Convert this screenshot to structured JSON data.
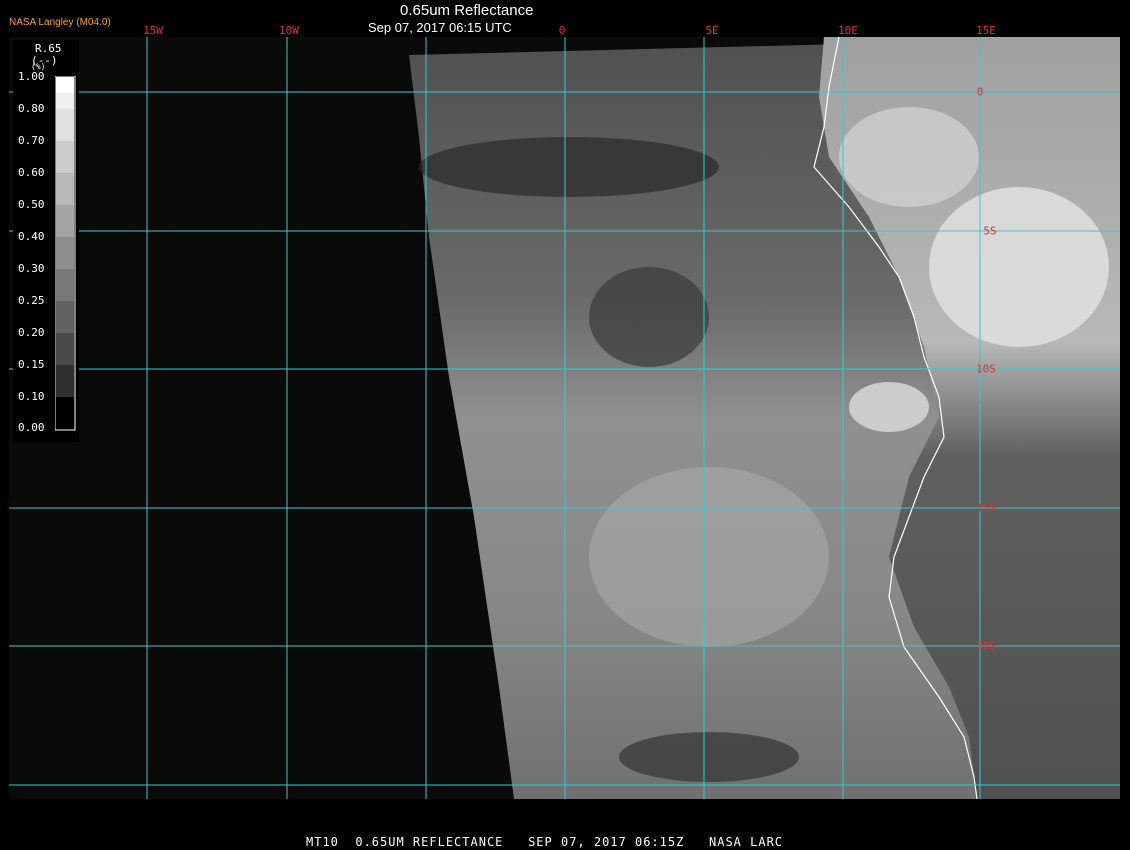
{
  "header": {
    "org": "NASA Langley (M04.0)",
    "title": "0.65um Reflectance",
    "datetime": "Sep 07, 2017 06:15 UTC"
  },
  "lon_labels": [
    "15W",
    "10W",
    "0",
    "5E",
    "10E",
    "15E"
  ],
  "lat_labels": [
    "0",
    "5S",
    "10S",
    "15S",
    "20S"
  ],
  "legend": {
    "title": "R.65",
    "units": "(--)",
    "unit_symbol": "(%)",
    "ticks": [
      "1.00",
      "0.80",
      "0.70",
      "0.60",
      "0.50",
      "0.40",
      "0.30",
      "0.25",
      "0.20",
      "0.15",
      "0.10",
      "0.00"
    ]
  },
  "footer": "MT10  0.65UM REFLECTANCE   SEP 07, 2017 06:15Z   NASA LARC",
  "colors": {
    "grid": "#36c8d0",
    "label_red": "#e03030",
    "org_orange": "#ffa030",
    "coast": "#ffffff"
  }
}
